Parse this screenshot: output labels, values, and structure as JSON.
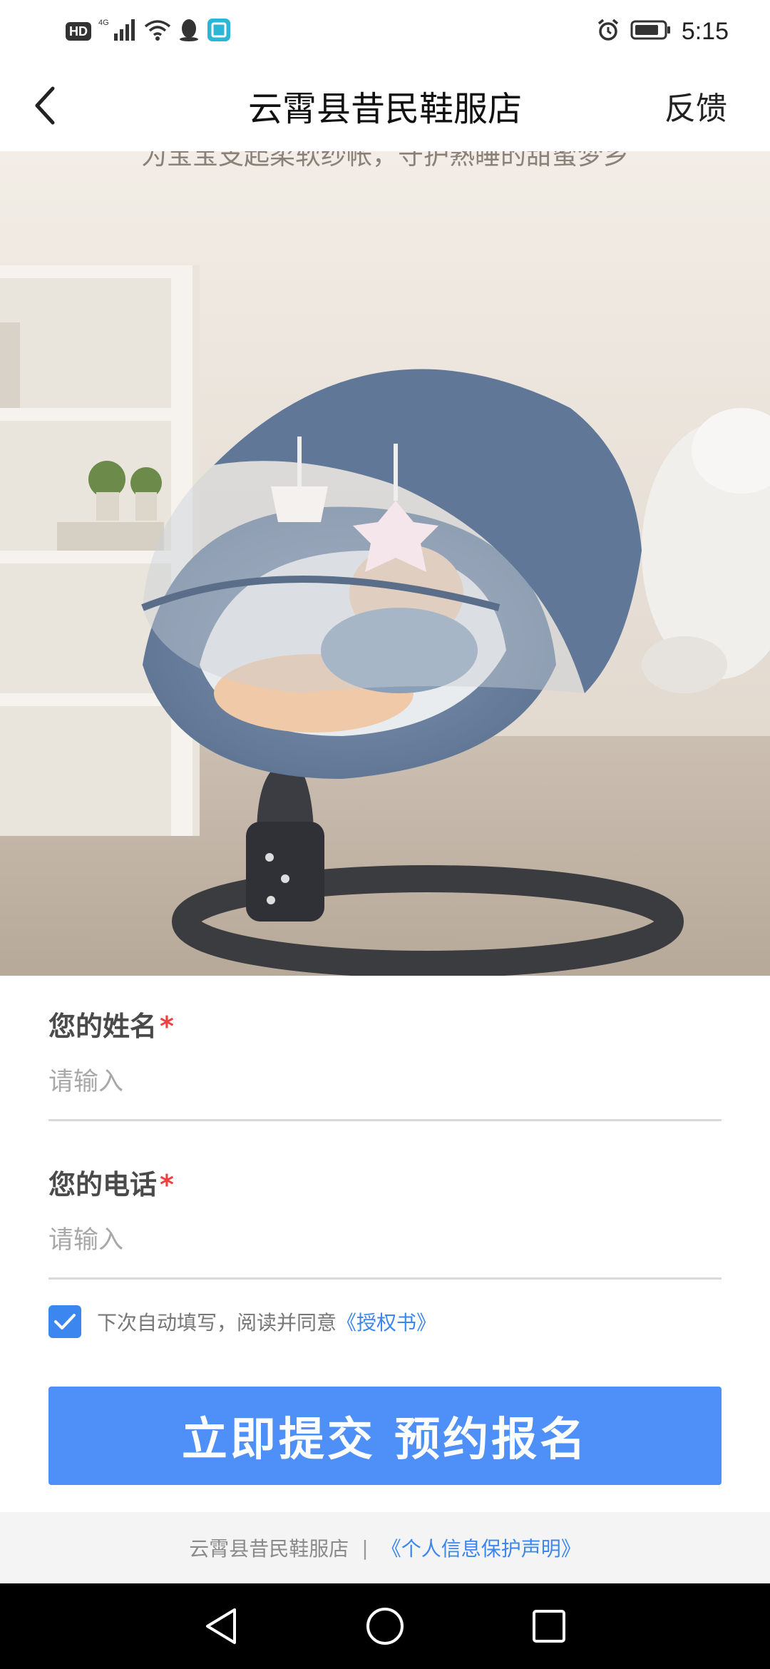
{
  "status_bar": {
    "hd": "HD",
    "network": "4G",
    "time": "5:15"
  },
  "nav": {
    "title": "云霄县昔民鞋服店",
    "feedback": "反馈"
  },
  "hero": {
    "banner_caption": "为宝宝支起柔软纱帐，守护熟睡的甜蜜梦乡"
  },
  "form": {
    "name_label": "您的姓名",
    "name_placeholder": "请输入",
    "phone_label": "您的电话",
    "phone_placeholder": "请输入",
    "required_mark": "*",
    "consent_text": "下次自动填写，阅读并同意",
    "consent_link": "《授权书》",
    "consent_checked": true,
    "submit_label": "立即提交  预约报名"
  },
  "footer": {
    "shop": "云霄县昔民鞋服店",
    "separator": "|",
    "privacy_link": "《个人信息保护声明》"
  },
  "colors": {
    "accent": "#3c86f0",
    "button": "#4e8ff8",
    "required": "#f04141"
  }
}
